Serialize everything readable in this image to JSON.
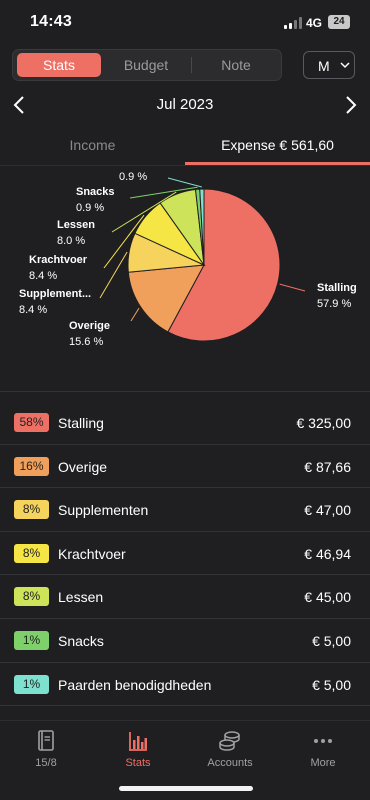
{
  "status": {
    "time": "14:43",
    "network": "4G",
    "battery": "24"
  },
  "top": {
    "tabs": [
      "Stats",
      "Budget",
      "Note"
    ],
    "active_tab": 0,
    "period": "M"
  },
  "nav": {
    "month": "Jul 2023"
  },
  "type_tabs": {
    "income": "Income",
    "expense": "Expense € 561,60"
  },
  "chart_data": {
    "type": "pie",
    "slices": [
      {
        "label": "Stalling",
        "percent_label": "57.9 %",
        "value": 325.0,
        "color": "#ee6f64"
      },
      {
        "label": "Overige",
        "percent_label": "15.6 %",
        "value": 87.66,
        "color": "#f0a05a"
      },
      {
        "label": "Supplement...",
        "percent_label": "8.4 %",
        "value": 47.0,
        "color": "#f5d35c"
      },
      {
        "label": "Krachtvoer",
        "percent_label": "8.4 %",
        "value": 46.94,
        "color": "#f6e645"
      },
      {
        "label": "Lessen",
        "percent_label": "8.0 %",
        "value": 45.0,
        "color": "#cde35a"
      },
      {
        "label": "Snacks",
        "percent_label": "0.9 %",
        "value": 5.0,
        "color": "#7ed06a"
      },
      {
        "label": "",
        "percent_label": "0.9 %",
        "value": 5.0,
        "color": "#7ee0cf"
      }
    ]
  },
  "categories": [
    {
      "percent": "58%",
      "name": "Stalling",
      "amount": "€ 325,00",
      "color": "#ee6f64"
    },
    {
      "percent": "16%",
      "name": "Overige",
      "amount": "€ 87,66",
      "color": "#f0a05a"
    },
    {
      "percent": "8%",
      "name": "Supplementen",
      "amount": "€ 47,00",
      "color": "#f5d35c"
    },
    {
      "percent": "8%",
      "name": "Krachtvoer",
      "amount": "€ 46,94",
      "color": "#f6e645"
    },
    {
      "percent": "8%",
      "name": "Lessen",
      "amount": "€ 45,00",
      "color": "#cde35a"
    },
    {
      "percent": "1%",
      "name": "Snacks",
      "amount": "€ 5,00",
      "color": "#7ed06a"
    },
    {
      "percent": "1%",
      "name": "Paarden benodigdheden",
      "amount": "€ 5,00",
      "color": "#7ee0cf"
    }
  ],
  "tabbar": [
    {
      "label": "15/8",
      "icon": "book-icon"
    },
    {
      "label": "Stats",
      "icon": "stats-icon"
    },
    {
      "label": "Accounts",
      "icon": "coins-icon"
    },
    {
      "label": "More",
      "icon": "more-icon"
    }
  ],
  "tabbar_active": 1
}
